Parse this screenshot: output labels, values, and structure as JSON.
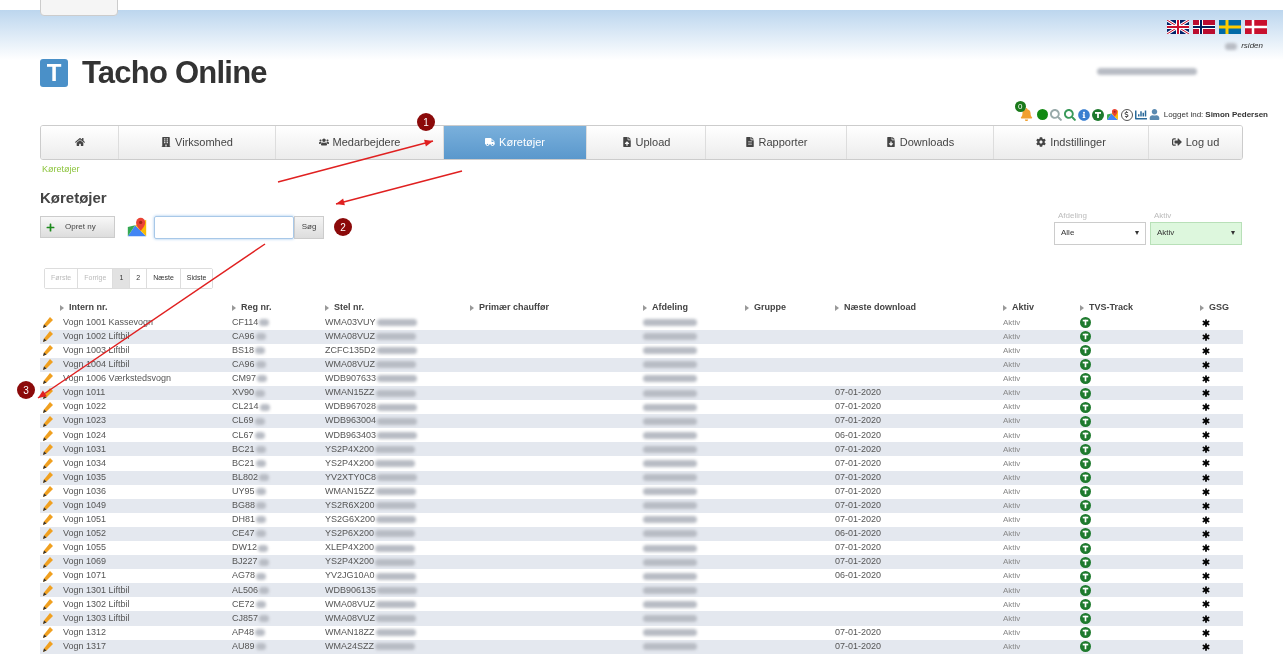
{
  "header": {
    "logo_letter": "T",
    "title": "Tacho Online",
    "flags": [
      {
        "kind": "uk"
      },
      {
        "kind": "no"
      },
      {
        "kind": "se"
      },
      {
        "kind": "dk"
      }
    ],
    "home_link": "rsiden",
    "notification_count": "0",
    "login_label": "Logget ind:",
    "user_name": "Simon Pedersen"
  },
  "nav": [
    {
      "selected": false
    },
    {
      "label": "Virksomhed",
      "selected": false
    },
    {
      "label": "Medarbejdere",
      "selected": false
    },
    {
      "label": "Køretøjer",
      "selected": true
    },
    {
      "label": "Upload",
      "selected": false
    },
    {
      "label": "Rapporter",
      "selected": false
    },
    {
      "label": "Downloads",
      "selected": false
    },
    {
      "label": "Indstillinger",
      "selected": false
    },
    {
      "label": "Log ud",
      "selected": false
    }
  ],
  "breadcrumb": "Køretøjer",
  "heading": "Køretøjer",
  "toolbar": {
    "create_button": "Opret ny",
    "search_button": "Søg"
  },
  "filters": [
    {
      "label": "Afdeling",
      "value": "Alle",
      "highlighted": false
    },
    {
      "label": "Aktiv",
      "value": "Aktiv",
      "highlighted": true
    }
  ],
  "pagination": [
    {
      "label": "Første",
      "disabled": true,
      "selected": false
    },
    {
      "label": "Forrige",
      "disabled": true,
      "selected": false
    },
    {
      "label": "1",
      "disabled": false,
      "selected": true
    },
    {
      "label": "2",
      "disabled": false,
      "selected": false
    },
    {
      "label": "Næste",
      "disabled": false,
      "selected": false
    },
    {
      "label": "Sidste",
      "disabled": false,
      "selected": false
    }
  ],
  "table": {
    "columns": [
      "Intern nr.",
      "Reg nr.",
      "Stel nr.",
      "Primær chauffør",
      "Afdeling",
      "Gruppe",
      "Næste download",
      "Aktiv",
      "TVS-Track",
      "GSG"
    ],
    "rows": [
      {
        "intern": "Vogn 1001 Kassevogn",
        "reg": "CF114",
        "stel": "WMA03VUY",
        "status": "Aktiv"
      },
      {
        "intern": "Vogn 1002 Liftbil",
        "reg": "CA96",
        "stel": "WMA08VUZ",
        "status": "Aktiv"
      },
      {
        "intern": "Vogn 1003 Liftbil",
        "reg": "BS18",
        "stel": "ZCFC135D2",
        "status": "Aktiv"
      },
      {
        "intern": "Vogn 1004 Liftbil",
        "reg": "CA96",
        "stel": "WMA08VUZ",
        "status": "Aktiv"
      },
      {
        "intern": "Vogn 1006 Værkstedsvogn",
        "reg": "CM97",
        "stel": "WDB907633",
        "status": "Aktiv"
      },
      {
        "intern": "Vogn 1011",
        "reg": "XV90",
        "stel": "WMAN15ZZ",
        "next_download": "07-01-2020",
        "status": "Aktiv"
      },
      {
        "intern": "Vogn 1022",
        "reg": "CL214",
        "stel": "WDB967028",
        "next_download": "07-01-2020",
        "status": "Aktiv"
      },
      {
        "intern": "Vogn 1023",
        "reg": "CL69",
        "stel": "WDB963004",
        "next_download": "07-01-2020",
        "status": "Aktiv"
      },
      {
        "intern": "Vogn 1024",
        "reg": "CL67",
        "stel": "WDB963403",
        "next_download": "06-01-2020",
        "status": "Aktiv"
      },
      {
        "intern": "Vogn 1031",
        "reg": "BC21",
        "stel": "YS2P4X200",
        "next_download": "07-01-2020",
        "status": "Aktiv"
      },
      {
        "intern": "Vogn 1034",
        "reg": "BC21",
        "stel": "YS2P4X200",
        "next_download": "07-01-2020",
        "status": "Aktiv"
      },
      {
        "intern": "Vogn 1035",
        "reg": "BL802",
        "stel": "YV2XTY0C8",
        "next_download": "07-01-2020",
        "status": "Aktiv"
      },
      {
        "intern": "Vogn 1036",
        "reg": "UY95",
        "stel": "WMAN15ZZ",
        "next_download": "07-01-2020",
        "status": "Aktiv"
      },
      {
        "intern": "Vogn 1049",
        "reg": "BG88",
        "stel": "YS2R6X200",
        "next_download": "07-01-2020",
        "status": "Aktiv"
      },
      {
        "intern": "Vogn 1051",
        "reg": "DH81",
        "stel": "YS2G6X200",
        "next_download": "07-01-2020",
        "status": "Aktiv"
      },
      {
        "intern": "Vogn 1052",
        "reg": "CE47",
        "stel": "YS2P6X200",
        "next_download": "06-01-2020",
        "status": "Aktiv"
      },
      {
        "intern": "Vogn 1055",
        "reg": "DW12",
        "stel": "XLEP4X200",
        "next_download": "07-01-2020",
        "status": "Aktiv"
      },
      {
        "intern": "Vogn 1069",
        "reg": "BJ227",
        "stel": "YS2P4X200",
        "next_download": "07-01-2020",
        "status": "Aktiv"
      },
      {
        "intern": "Vogn 1071",
        "reg": "AG78",
        "stel": "YV2JG10A0",
        "next_download": "06-01-2020",
        "status": "Aktiv"
      },
      {
        "intern": "Vogn 1301 Liftbil",
        "reg": "AL506",
        "stel": "WDB906135",
        "status": "Aktiv"
      },
      {
        "intern": "Vogn 1302 Liftbil",
        "reg": "CE72",
        "stel": "WMA08VUZ",
        "status": "Aktiv"
      },
      {
        "intern": "Vogn 1303 Liftbil",
        "reg": "CJ857",
        "stel": "WMA08VUZ",
        "status": "Aktiv"
      },
      {
        "intern": "Vogn 1312",
        "reg": "AP48",
        "stel": "WMAN18ZZ",
        "next_download": "07-01-2020",
        "status": "Aktiv"
      },
      {
        "intern": "Vogn 1317",
        "reg": "AU89",
        "stel": "WMA24SZZ",
        "next_download": "07-01-2020",
        "status": "Aktiv"
      }
    ]
  },
  "annotations": [
    {
      "label": "1"
    },
    {
      "label": "2"
    },
    {
      "label": "3"
    }
  ]
}
